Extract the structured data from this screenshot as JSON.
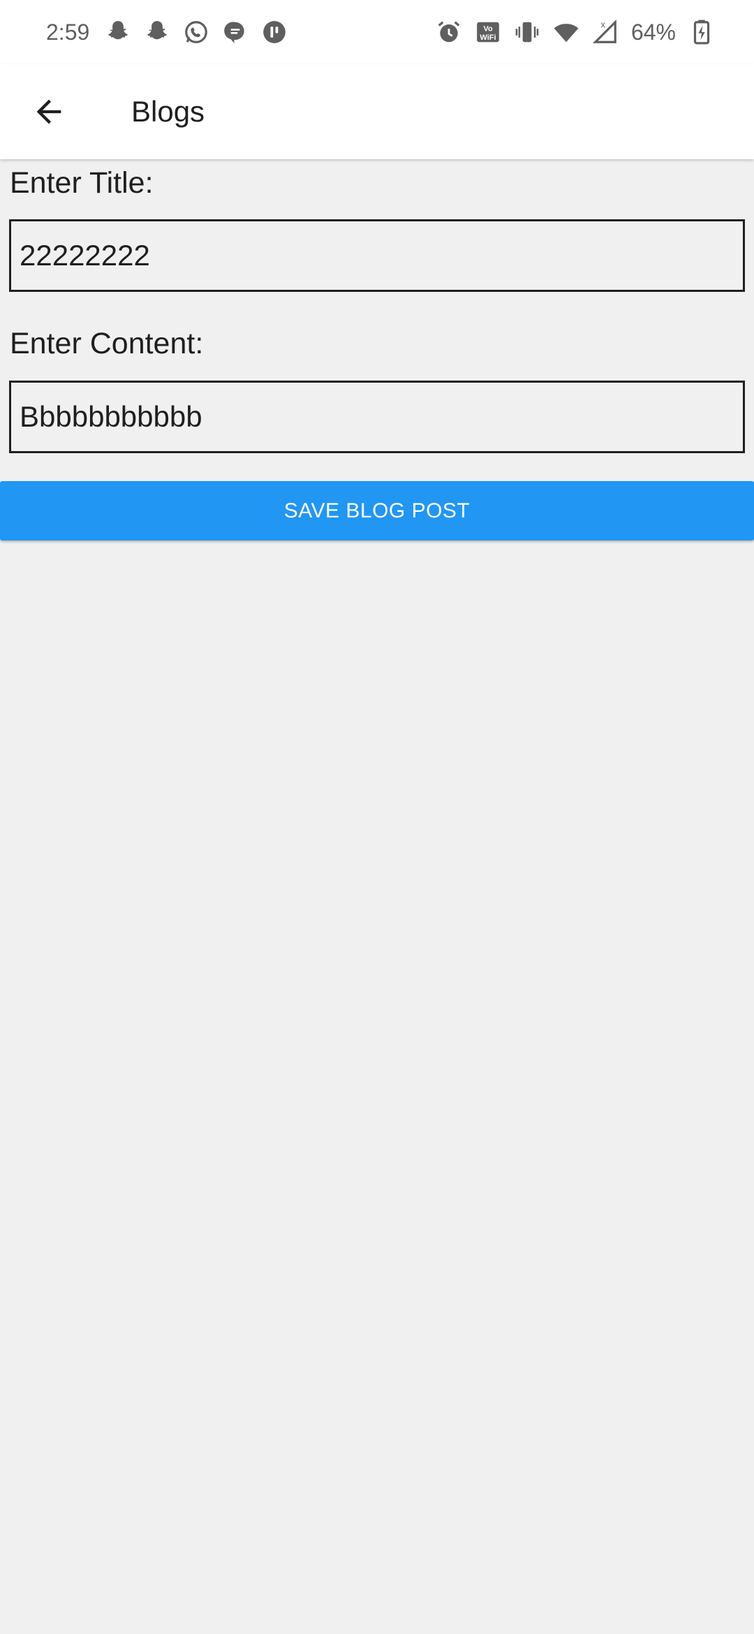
{
  "status_bar": {
    "time": "2:59",
    "battery": "64%",
    "left_icons": [
      "snapchat-icon",
      "snapchat-icon",
      "whatsapp-icon",
      "messages-icon",
      "teams-icon"
    ],
    "right_icons": [
      "alarm-icon",
      "vowifi-icon",
      "vibrate-icon",
      "wifi-icon",
      "signal-icon",
      "battery-charging-icon"
    ]
  },
  "app_bar": {
    "title": "Blogs",
    "back_icon": "arrow-back-icon"
  },
  "form": {
    "title_label": "Enter Title:",
    "title_value": "22222222",
    "content_label": "Enter Content:",
    "content_value": "Bbbbbbbbbbb",
    "save_label": "SAVE BLOG POST"
  },
  "colors": {
    "accent": "#2196f3",
    "background": "#f0f0f0",
    "app_bar": "#ffffff"
  }
}
